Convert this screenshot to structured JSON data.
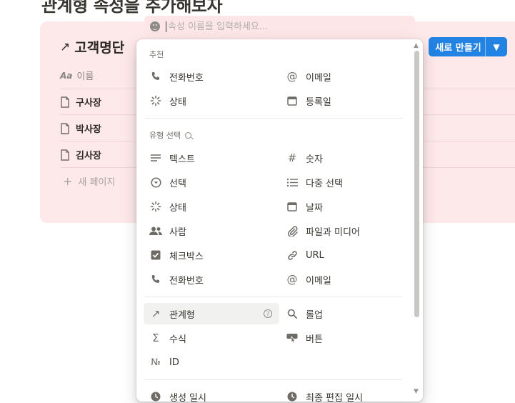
{
  "page": {
    "title": "관계형 속성을 추가해보자"
  },
  "database": {
    "title": "고객명단",
    "new_button": "새로 만들기",
    "column_header": "이름",
    "rows": [
      "구사장",
      "박사장",
      "김사장"
    ],
    "new_page": "새 페이지"
  },
  "search": {
    "placeholder": "속성 이름을 입력하세요..."
  },
  "menu": {
    "suggested_label": "추천",
    "suggested": [
      {
        "label": "전화번호",
        "icon": "phone-icon"
      },
      {
        "label": "이메일",
        "icon": "at-icon"
      },
      {
        "label": "상태",
        "icon": "status-icon"
      },
      {
        "label": "등록일",
        "icon": "calendar-icon"
      }
    ],
    "types_label": "유형 선택",
    "types": [
      {
        "label": "텍스트",
        "icon": "text-icon"
      },
      {
        "label": "숫자",
        "icon": "hash-icon"
      },
      {
        "label": "선택",
        "icon": "select-icon"
      },
      {
        "label": "다중 선택",
        "icon": "list-icon"
      },
      {
        "label": "상태",
        "icon": "status-icon"
      },
      {
        "label": "날짜",
        "icon": "calendar-icon"
      },
      {
        "label": "사람",
        "icon": "people-icon"
      },
      {
        "label": "파일과 미디어",
        "icon": "paperclip-icon"
      },
      {
        "label": "체크박스",
        "icon": "checkbox-icon"
      },
      {
        "label": "URL",
        "icon": "link-icon"
      },
      {
        "label": "전화번호",
        "icon": "phone-icon"
      },
      {
        "label": "이메일",
        "icon": "at-icon"
      }
    ],
    "advanced": [
      {
        "label": "관계형",
        "icon": "relation-arrow-icon"
      },
      {
        "label": "롤업",
        "icon": "search-icon"
      },
      {
        "label": "수식",
        "icon": "sigma-icon"
      },
      {
        "label": "버튼",
        "icon": "button-cursor-icon"
      },
      {
        "label": "ID",
        "icon": "numero-icon"
      }
    ],
    "timestamps": [
      {
        "label": "생성 일시",
        "icon": "clock-icon"
      },
      {
        "label": "최종 편집 일시",
        "icon": "clock-icon"
      }
    ]
  },
  "colors": {
    "accent": "#2383e2",
    "db_background": "#fde8ea"
  }
}
